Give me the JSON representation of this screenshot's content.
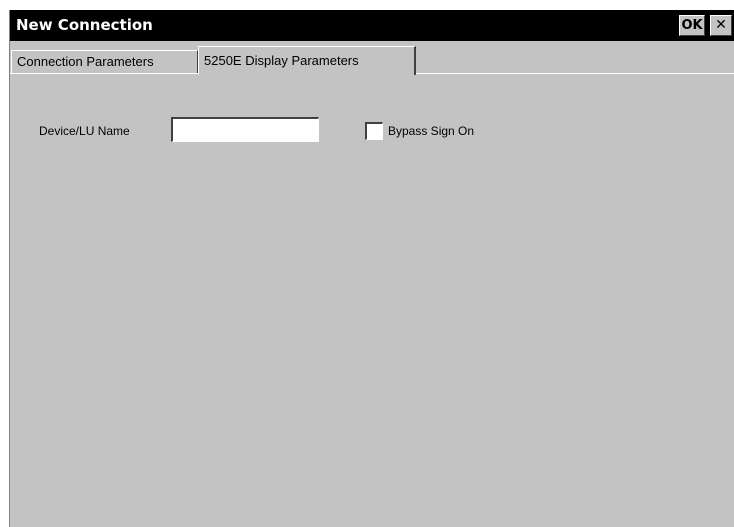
{
  "window": {
    "title": "New Connection",
    "ok_label": "OK",
    "close_label": "✕"
  },
  "tabs": [
    {
      "label": "Connection Parameters",
      "active": false
    },
    {
      "label": "5250E Display Parameters",
      "active": true
    }
  ],
  "form": {
    "device_label": "Device/LU Name",
    "device_value": "",
    "bypass_label": "Bypass Sign On",
    "bypass_checked": false
  }
}
